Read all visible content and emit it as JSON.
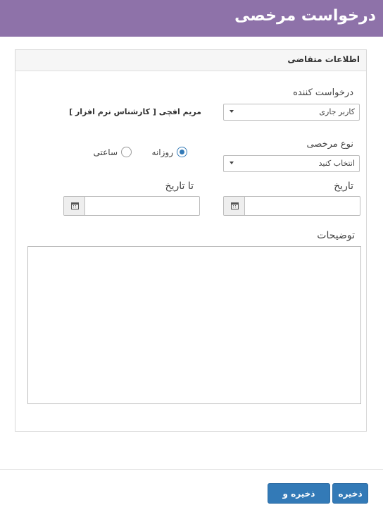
{
  "header": {
    "title": "درخواست مرخصی"
  },
  "panel": {
    "title": "اطلاعات متقاضی"
  },
  "form": {
    "requester_label": "درخواست کننده",
    "requester_value": "کاربر جاری",
    "requester_name": "مریم افچی [ کارشناس نرم افزار ]",
    "leave_type_label": "نوع مرخصی",
    "leave_type_value": "انتخاب کنید",
    "radio_daily_label": "روزانه",
    "radio_daily_checked": true,
    "radio_hourly_label": "ساعتی",
    "radio_hourly_checked": false,
    "from_date_label": "تاریخ",
    "from_date_value": "",
    "to_date_label": "تا تاریخ",
    "to_date_value": "",
    "description_label": "توضیحات",
    "description_value": ""
  },
  "buttons": {
    "save": "ذخیره",
    "save_and_return": "ذخیره و ارجاع"
  },
  "colors": {
    "header_bg": "#8e72a9",
    "button_bg": "#337ab7"
  },
  "icons": [
    "calendar-icon",
    "caret-down-icon",
    "radio-checked-icon",
    "radio-unchecked-icon"
  ]
}
